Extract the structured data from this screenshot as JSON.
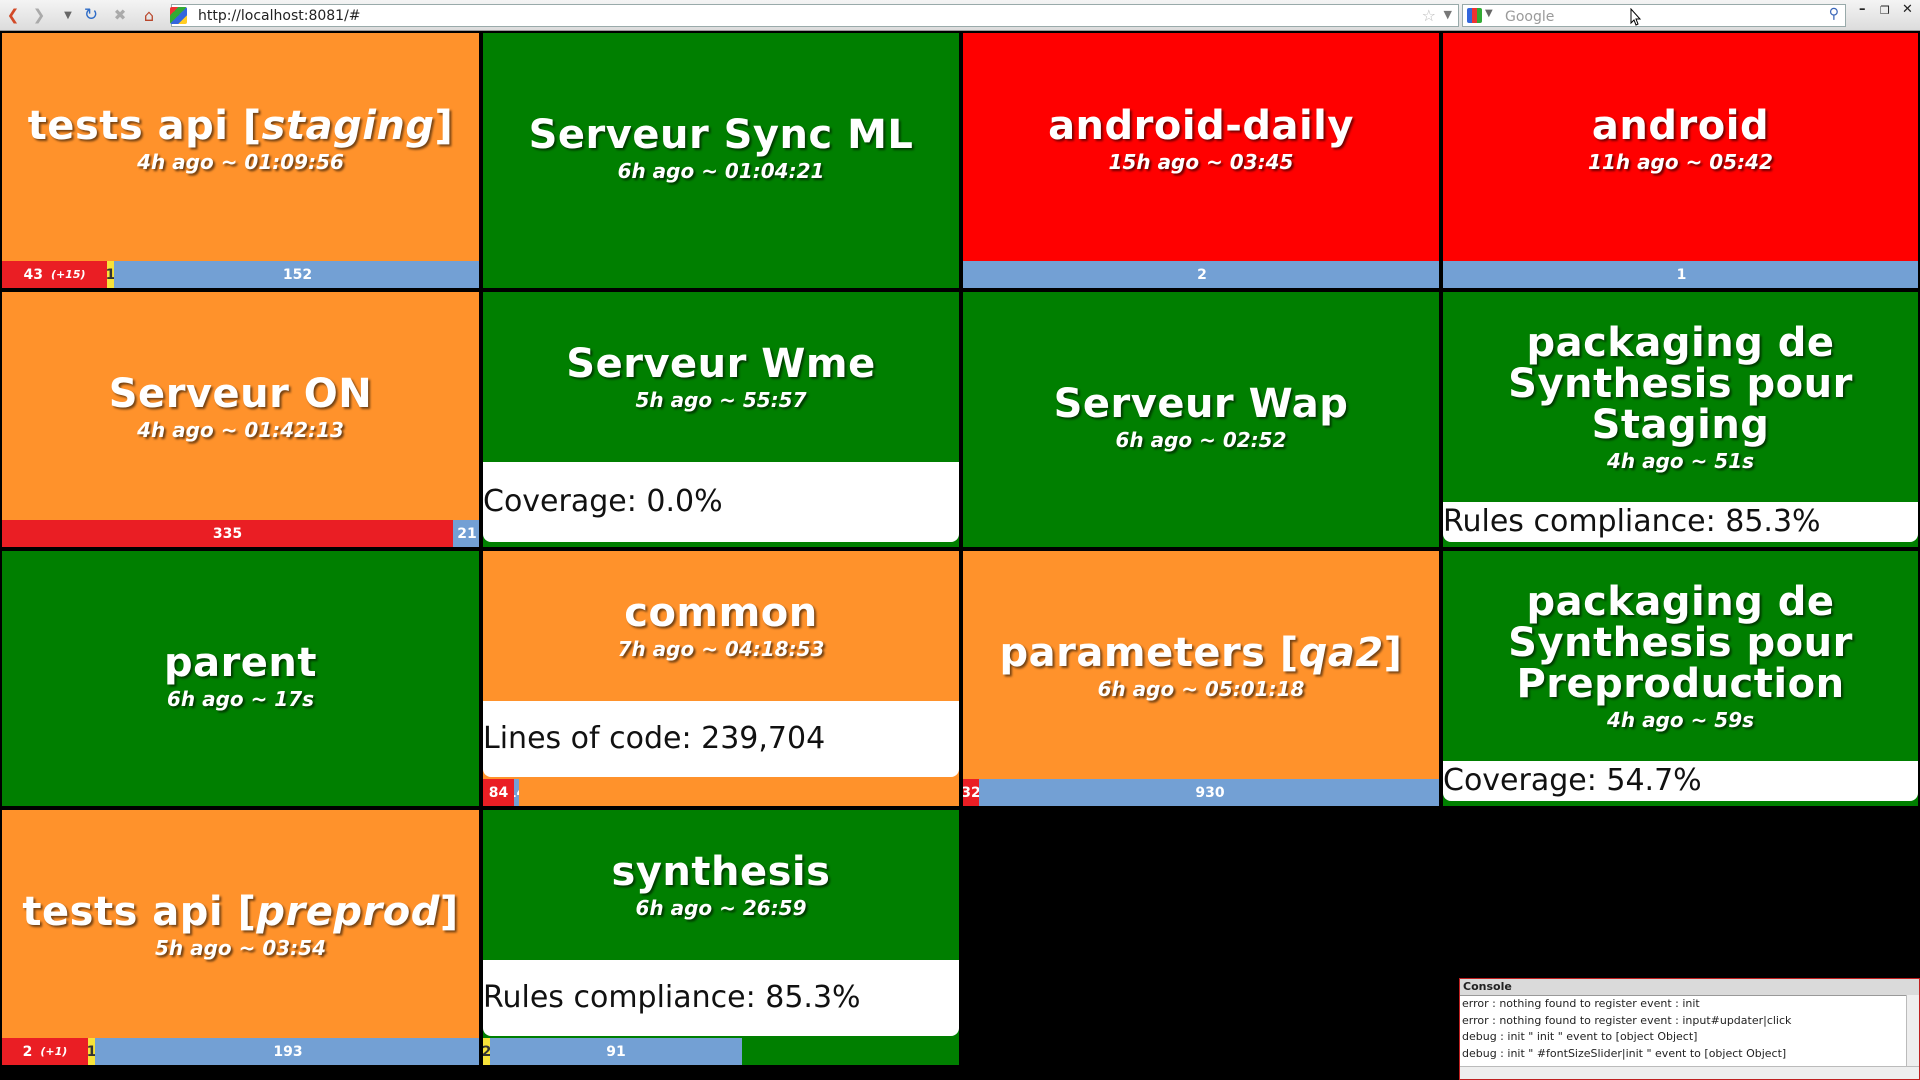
{
  "browser": {
    "url": "http://localhost:8081/#",
    "search_placeholder": "Google",
    "icons": [
      "back-icon",
      "forward-icon",
      "history-dropdown-icon",
      "reload-icon",
      "stop-icon",
      "home-icon"
    ]
  },
  "colors": {
    "success": "#007f00",
    "unstable": "#ff922b",
    "failure": "#ff0000",
    "failed_tests": "#ea1e24",
    "skipped_tests": "#f7e23a",
    "passed_tests": "#73a0d4"
  },
  "jobs": [
    {
      "name": "tests api [",
      "name_em": "staging",
      "name_end": "]",
      "status": "unstable",
      "time": "4h ago ~ 01:09:56",
      "tests": {
        "failed": "43",
        "failed_delta": "(+15)",
        "skipped": "1",
        "passed": "152",
        "failed_n": 43,
        "skipped_n": 1,
        "passed_n": 152
      }
    },
    {
      "name": "Serveur Sync ML",
      "status": "success",
      "time": "6h ago ~ 01:04:21"
    },
    {
      "name": "android-daily",
      "status": "failure",
      "time": "15h ago ~ 03:45",
      "tests": {
        "passed": "2",
        "passed_n": 2
      }
    },
    {
      "name": "android",
      "status": "failure",
      "time": "11h ago ~ 05:42",
      "tests": {
        "passed": "1",
        "passed_n": 1
      }
    },
    {
      "name": "Serveur ON",
      "status": "unstable",
      "time": "4h ago ~ 01:42:13",
      "tests": {
        "failed": "335",
        "passed": "21",
        "failed_n": 335,
        "passed_n": 21
      }
    },
    {
      "name": "Serveur Wme",
      "status": "success",
      "time": "5h ago ~ 55:57",
      "metric": "Coverage: 0.0%"
    },
    {
      "name": "Serveur Wap",
      "status": "success",
      "time": "6h ago ~ 02:52"
    },
    {
      "name": "packaging de Synthesis pour Staging",
      "status": "success",
      "time": "4h ago ~ 51s",
      "metric": "Rules compliance: 85.3%"
    },
    {
      "name": "parent",
      "status": "success",
      "time": "6h ago ~ 17s"
    },
    {
      "name": "common",
      "status": "unstable",
      "time": "7h ago ~ 04:18:53",
      "metric": "Lines of code: 239,704",
      "tests": {
        "failed": "84",
        "passed": "14",
        "failed_n": 84,
        "passed_n": 14
      }
    },
    {
      "name": "parameters [",
      "name_em": "qa2",
      "name_end": "]",
      "status": "unstable",
      "time": "6h ago ~ 05:01:18",
      "tests": {
        "failed": "32",
        "passed": "930",
        "failed_n": 32,
        "passed_n": 930
      }
    },
    {
      "name": "packaging de Synthesis pour Preproduction",
      "status": "success",
      "time": "4h ago ~ 59s",
      "metric": "Coverage: 54.7%"
    },
    {
      "name": "tests api [",
      "name_em": "preprod",
      "name_end": "]",
      "status": "unstable",
      "time": "5h ago ~ 03:54",
      "tests": {
        "failed": "2",
        "failed_delta": "(+1)",
        "skipped": "1",
        "passed": "193",
        "failed_n": 2,
        "skipped_n": 1,
        "passed_n": 193
      }
    },
    {
      "name": "synthesis",
      "status": "success",
      "time": "6h ago ~ 26:59",
      "metric": "Rules compliance: 85.3%",
      "tests": {
        "skipped": "2",
        "passed": "91",
        "skipped_n": 2,
        "passed_n": 91
      }
    }
  ],
  "console": {
    "title": "Console",
    "lines": [
      "error : nothing found to register event : init",
      "error : nothing found to register event : input#updater|click",
      "debug : init \" init \" event to [object Object]",
      "debug : init \" #fontSizeSlider|init \" event to [object Object]"
    ]
  }
}
